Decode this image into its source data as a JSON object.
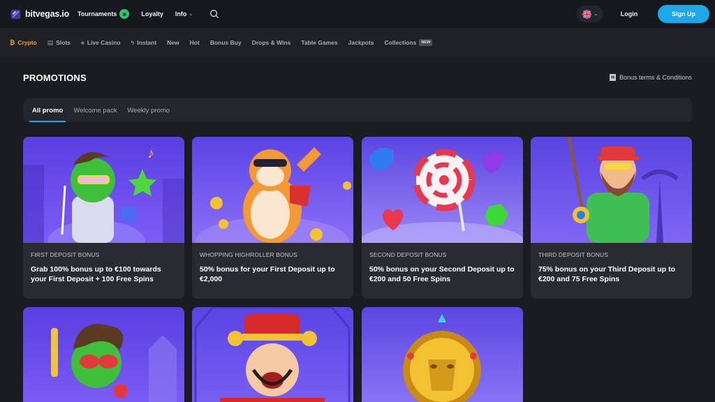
{
  "header": {
    "logo_text": "bitvegas.io",
    "nav": [
      {
        "label": "Tournaments"
      },
      {
        "label": "Loyalty"
      },
      {
        "label": "Info"
      }
    ],
    "login_label": "Login",
    "signup_label": "Sign Up"
  },
  "categories": [
    {
      "label": "Crypto",
      "icon": "bitcoin-icon",
      "active": true
    },
    {
      "label": "Slots",
      "icon": "slot-machine-icon"
    },
    {
      "label": "Live Casino",
      "icon": "spade-icon"
    },
    {
      "label": "Instant",
      "icon": "lightning-icon"
    },
    {
      "label": "New"
    },
    {
      "label": "Hot"
    },
    {
      "label": "Bonus Buy"
    },
    {
      "label": "Drops & Wins"
    },
    {
      "label": "Table Games"
    },
    {
      "label": "Jackpots"
    },
    {
      "label": "Collections",
      "badge": "NEW"
    }
  ],
  "main": {
    "title": "PROMOTIONS",
    "terms_label": "Bonus terms & Conditions",
    "tabs": [
      {
        "label": "All promo",
        "active": true
      },
      {
        "label": "Welcome pack"
      },
      {
        "label": "Weekly promo"
      }
    ]
  },
  "promos": [
    {
      "label": "FIRST DEPOSIT BONUS",
      "desc": "Grab 100% bonus up to €100 towards your First Deposit + 100 Free Spins"
    },
    {
      "label": "WHOPPING HIGHROLLER BONUS",
      "desc": "50% bonus for your First Deposit up to €2,000"
    },
    {
      "label": "SECOND DEPOSIT BONUS",
      "desc": "50% bonus on your Second Deposit up to €200 and 50 Free Spins"
    },
    {
      "label": "THIRD DEPOSIT BONUS",
      "desc": "75% bonus on your Third Deposit up to €200 and 75 Free Spins"
    }
  ],
  "colors": {
    "accent": "#1da6ea",
    "crypto": "#f6a623",
    "promo_bg": "#6e4cf0"
  }
}
